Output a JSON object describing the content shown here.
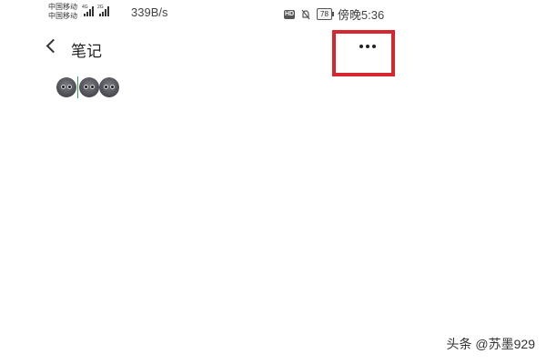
{
  "status_bar": {
    "carriers": [
      "中国移动",
      "中国移动"
    ],
    "signals": [
      {
        "net": "4G",
        "bars": 4
      },
      {
        "net": "2G",
        "bars": 4
      }
    ],
    "speed": "339B/s",
    "icons": [
      "hd-icon",
      "mute-icon",
      "battery-icon"
    ],
    "hd_label": "HD",
    "battery": "78",
    "time": "傍晚5:36"
  },
  "header": {
    "back_icon": "chevron-left-icon",
    "title": "笔记",
    "more_icon": "more-horizontal-icon",
    "highlight_color": "#d6262f"
  },
  "content": {
    "emojis": [
      "grimacing-face",
      "grimacing-face",
      "grimacing-face"
    ],
    "cursor_color": "#3aa655"
  },
  "watermark": "头条 @苏墨929"
}
